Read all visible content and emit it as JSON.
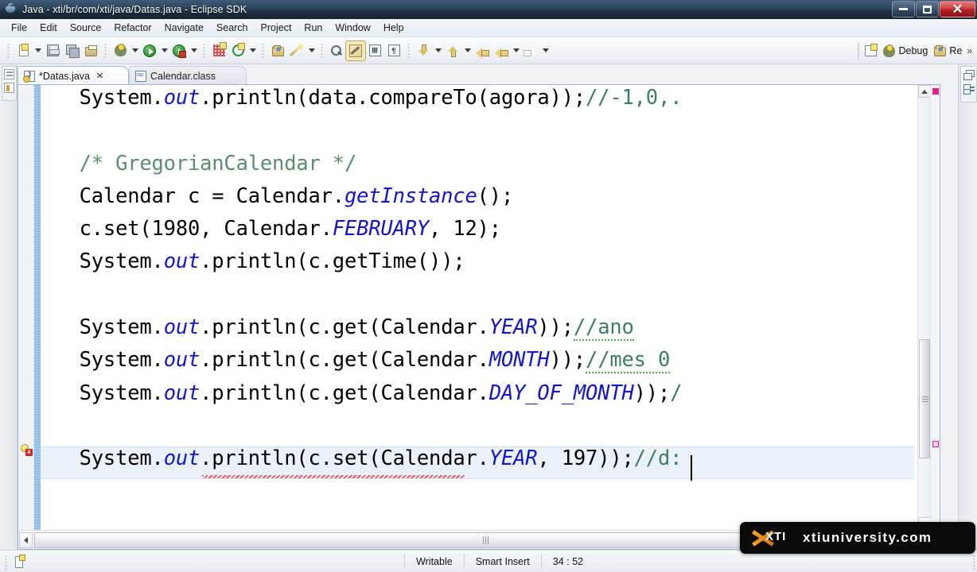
{
  "window": {
    "title": "Java - xti/br/com/xti/java/Datas.java - Eclipse SDK",
    "app_icon": "java-cup-icon",
    "controls": {
      "minimize": "minimize-button",
      "maximize": "maximize-button",
      "close": "✕"
    }
  },
  "menubar": {
    "items": [
      "File",
      "Edit",
      "Source",
      "Refactor",
      "Navigate",
      "Search",
      "Project",
      "Run",
      "Window",
      "Help"
    ]
  },
  "toolbar": {
    "groups": [
      {
        "buttons": [
          {
            "name": "new-wizard-button",
            "icon": "new-document-icon",
            "dropdown": true
          },
          {
            "name": "save-button",
            "icon": "save-icon",
            "dropdown": false
          },
          {
            "name": "save-all-button",
            "icon": "save-all-icon",
            "dropdown": false
          },
          {
            "name": "print-button",
            "icon": "print-icon",
            "dropdown": false
          }
        ]
      },
      {
        "buttons": [
          {
            "name": "debug-button",
            "icon": "debug-bug-icon",
            "dropdown": true
          },
          {
            "name": "run-button",
            "icon": "run-green-play-icon",
            "dropdown": true
          },
          {
            "name": "run-last-button",
            "icon": "run-history-icon",
            "dropdown": true
          }
        ]
      },
      {
        "buttons": [
          {
            "name": "coverage-button",
            "icon": "coverage-grid-icon",
            "dropdown": false
          },
          {
            "name": "external-tools-button",
            "icon": "target-ring-icon",
            "dropdown": true
          }
        ]
      },
      {
        "buttons": [
          {
            "name": "open-type-button",
            "icon": "open-folder-icon",
            "dropdown": false
          },
          {
            "name": "new-java-project-button",
            "icon": "magic-wand-icon",
            "dropdown": true
          }
        ]
      },
      {
        "buttons": [
          {
            "name": "search-button",
            "icon": "search-magnifier-icon",
            "dropdown": false
          },
          {
            "name": "toggle-mark-occurrences-button",
            "icon": "pencil-highlight-icon",
            "pressed": true
          },
          {
            "name": "show-whitespace-button",
            "icon": "boxed-letter-icon",
            "glyph": "⊞"
          },
          {
            "name": "toggle-block-selection-button",
            "icon": "pilcrow-icon",
            "glyph": "¶"
          }
        ]
      },
      {
        "buttons": [
          {
            "name": "next-annotation-button",
            "icon": "arrow-down-yellow-icon",
            "dropdown": true
          },
          {
            "name": "previous-annotation-button",
            "icon": "arrow-up-yellow-icon",
            "dropdown": true
          },
          {
            "name": "last-edit-location-button",
            "icon": "back-to-edit-arrow-icon",
            "dropdown": false
          },
          {
            "name": "back-button",
            "icon": "back-arrow-icon",
            "dropdown": true
          },
          {
            "name": "forward-button",
            "icon": "forward-arrow-icon",
            "dropdown": true
          }
        ]
      }
    ],
    "perspectives": [
      {
        "name": "open-perspective-button",
        "icon": "open-perspective-icon",
        "label": ""
      },
      {
        "name": "perspective-debug",
        "icon": "debug-bug-icon",
        "label": "Debug"
      },
      {
        "name": "perspective-resource",
        "icon": "resource-folder-icon",
        "label": "Re"
      }
    ],
    "overflow": "»"
  },
  "fastview": {
    "items": [
      {
        "name": "package-explorer-fastview",
        "icon": "package-explorer-icon"
      },
      {
        "name": "outline-fastview",
        "icon": "outline-icon"
      }
    ]
  },
  "editor": {
    "tabs": [
      {
        "label": "*Datas.java",
        "icon": "java-file-icon",
        "active": true,
        "closeable": true,
        "close_glyph": "✕"
      },
      {
        "label": "Calendar.class",
        "icon": "class-file-icon",
        "active": false,
        "closeable": false
      }
    ],
    "code_lines": [
      {
        "indent": 0,
        "clipped_top": true,
        "tokens": [
          {
            "t": "System.",
            "c": ""
          },
          {
            "t": "out",
            "c": "fld"
          },
          {
            "t": ".println(data.compareTo(agora));",
            "c": ""
          },
          {
            "t": "//-1,0,.",
            "c": "cmt"
          }
        ]
      },
      {
        "indent": 0,
        "tokens": []
      },
      {
        "indent": 0,
        "tokens": [
          {
            "t": "/* GregorianCalendar */",
            "c": "blkcmt"
          }
        ]
      },
      {
        "indent": 0,
        "tokens": [
          {
            "t": "Calendar c = Calendar.",
            "c": ""
          },
          {
            "t": "getInstance",
            "c": "fld"
          },
          {
            "t": "();",
            "c": ""
          }
        ]
      },
      {
        "indent": 0,
        "tokens": [
          {
            "t": "c.set(1980, Calendar.",
            "c": ""
          },
          {
            "t": "FEBRUARY",
            "c": "fld"
          },
          {
            "t": ", 12);",
            "c": ""
          }
        ]
      },
      {
        "indent": 0,
        "tokens": [
          {
            "t": "System.",
            "c": ""
          },
          {
            "t": "out",
            "c": "fld"
          },
          {
            "t": ".println(c.getTime());",
            "c": ""
          }
        ]
      },
      {
        "indent": 0,
        "tokens": []
      },
      {
        "indent": 0,
        "tokens": [
          {
            "t": "System.",
            "c": ""
          },
          {
            "t": "out",
            "c": "fld"
          },
          {
            "t": ".println(c.get(Calendar.",
            "c": ""
          },
          {
            "t": "YEAR",
            "c": "fld"
          },
          {
            "t": "));",
            "c": ""
          },
          {
            "t": "//ano",
            "c": "cmt"
          }
        ]
      },
      {
        "indent": 0,
        "tokens": [
          {
            "t": "System.",
            "c": ""
          },
          {
            "t": "out",
            "c": "fld"
          },
          {
            "t": ".println(c.get(Calendar.",
            "c": ""
          },
          {
            "t": "MONTH",
            "c": "fld"
          },
          {
            "t": "));",
            "c": ""
          },
          {
            "t": "//mes 0",
            "c": "cmt"
          }
        ]
      },
      {
        "indent": 0,
        "tokens": [
          {
            "t": "System.",
            "c": ""
          },
          {
            "t": "out",
            "c": "fld"
          },
          {
            "t": ".println(c.get(Calendar.",
            "c": ""
          },
          {
            "t": "DAY_OF_MONTH",
            "c": "fld"
          },
          {
            "t": "));",
            "c": ""
          },
          {
            "t": "/",
            "c": "cmt"
          }
        ]
      },
      {
        "indent": 0,
        "tokens": []
      },
      {
        "indent": 0,
        "highlight": true,
        "tokens": [
          {
            "t": "System.",
            "c": ""
          },
          {
            "t": "out",
            "c": "fld"
          },
          {
            "t": ".println(c.set(Calendar.",
            "c": ""
          },
          {
            "t": "YEAR",
            "c": "fld"
          },
          {
            "t": ", 197",
            "c": ""
          },
          {
            "t": "));",
            "c": ""
          },
          {
            "t": "//d:",
            "c": "cmt"
          }
        ]
      }
    ],
    "caret": {
      "after_text": "197",
      "line": 12
    },
    "error_marker": {
      "name": "error-quick-fix-marker",
      "glyph": "x"
    },
    "overview_markers": [
      {
        "type": "err",
        "name": "overview-error-marker"
      },
      {
        "type": "warn",
        "name": "overview-warning-marker"
      }
    ],
    "scrollbars": {
      "vertical": {
        "up_glyph": "▲",
        "down_glyph": "▼"
      },
      "horizontal": {
        "left_glyph": "◀"
      }
    }
  },
  "rightbar": {
    "items": [
      {
        "name": "restore-view-button",
        "icon": "restore-icon"
      },
      {
        "name": "outline-view-button",
        "icon": "outline-icon"
      }
    ]
  },
  "statusbar": {
    "icon": "editor-status-icon",
    "writable": "Writable",
    "insert_mode": "Smart Insert",
    "position": "34 : 52"
  },
  "watermark": {
    "logo_text": "XTI",
    "site": "xtiuniversity.com",
    "accent_color": "#f6a623"
  }
}
